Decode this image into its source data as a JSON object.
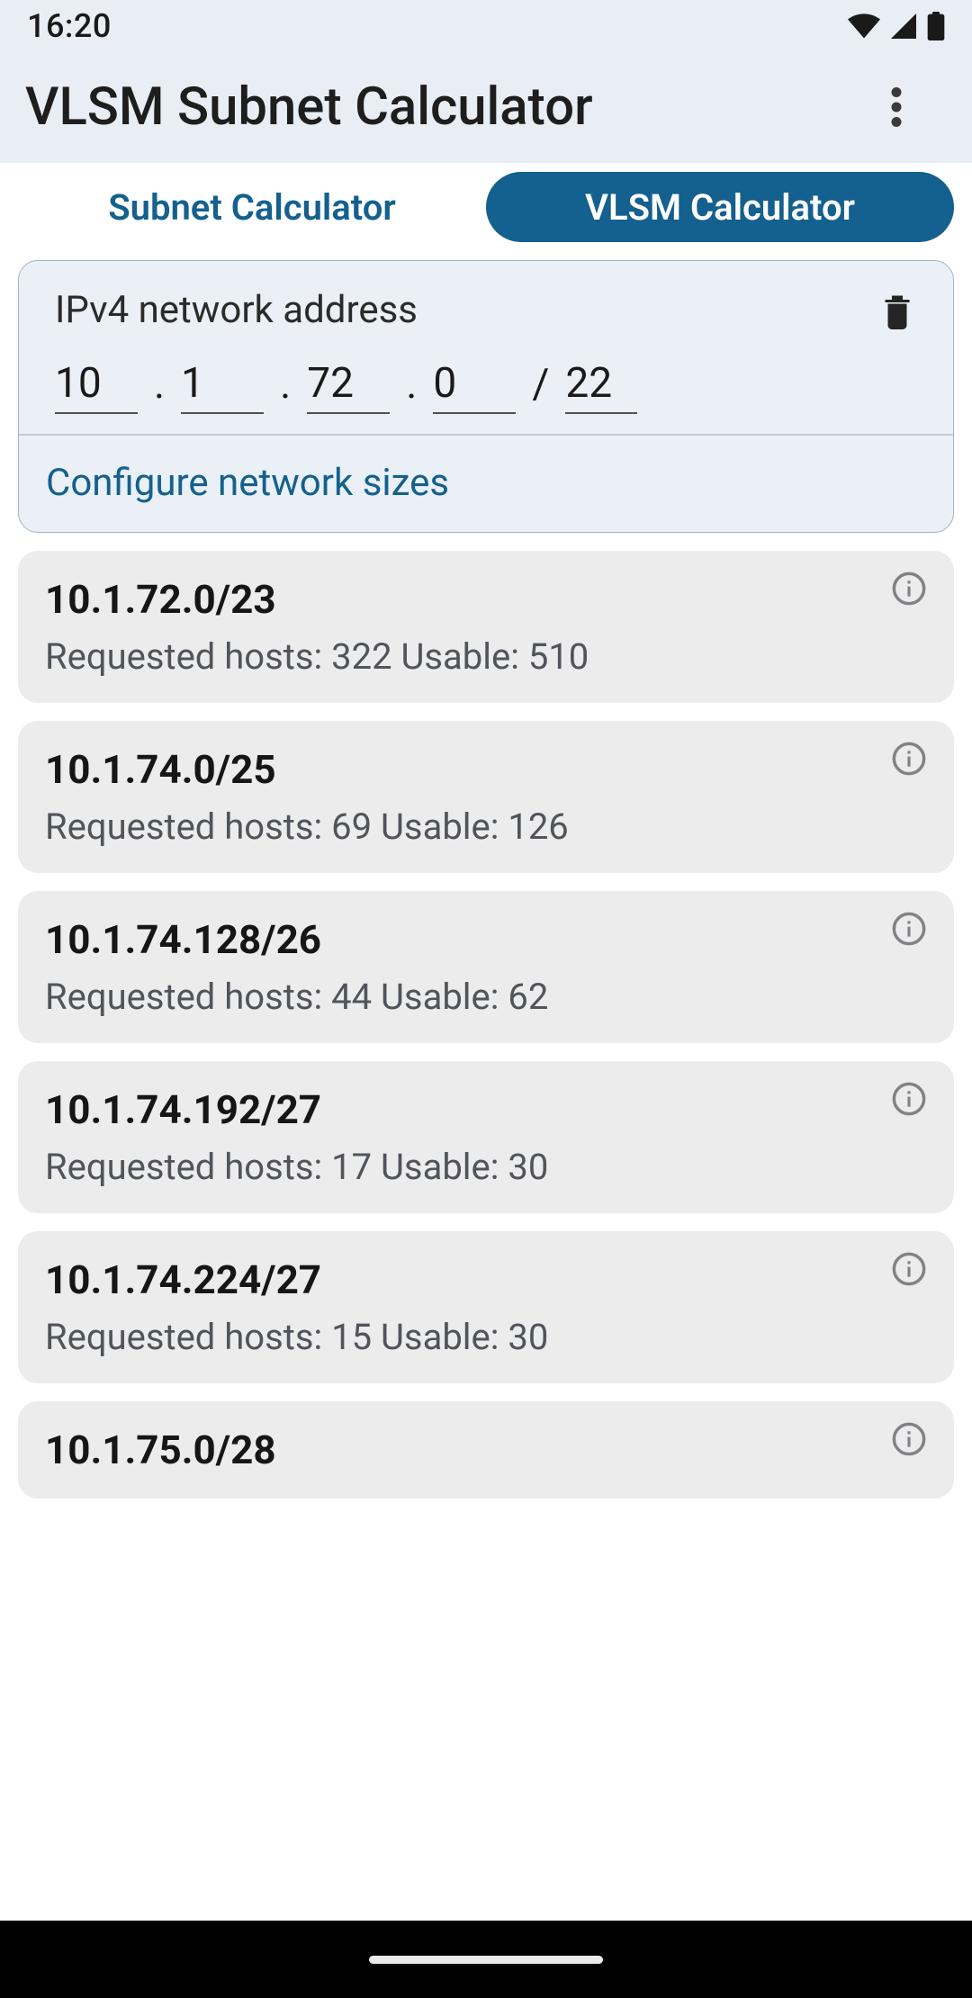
{
  "status": {
    "time": "16:20"
  },
  "appbar": {
    "title": "VLSM Subnet Calculator"
  },
  "tabs": {
    "subnet": "Subnet Calculator",
    "vlsm": "VLSM Calculator"
  },
  "input": {
    "label": "IPv4 network address",
    "o1": "10",
    "o2": "1",
    "o3": "72",
    "o4": "0",
    "cidr": "22",
    "configure": "Configure network sizes"
  },
  "results": [
    {
      "net": "10.1.72.0/23",
      "hosts": "Requested hosts: 322 Usable: 510"
    },
    {
      "net": "10.1.74.0/25",
      "hosts": "Requested hosts: 69 Usable: 126"
    },
    {
      "net": "10.1.74.128/26",
      "hosts": "Requested hosts: 44 Usable: 62"
    },
    {
      "net": "10.1.74.192/27",
      "hosts": "Requested hosts: 17 Usable: 30"
    },
    {
      "net": "10.1.74.224/27",
      "hosts": "Requested hosts: 15 Usable: 30"
    },
    {
      "net": "10.1.75.0/28",
      "hosts": ""
    }
  ]
}
